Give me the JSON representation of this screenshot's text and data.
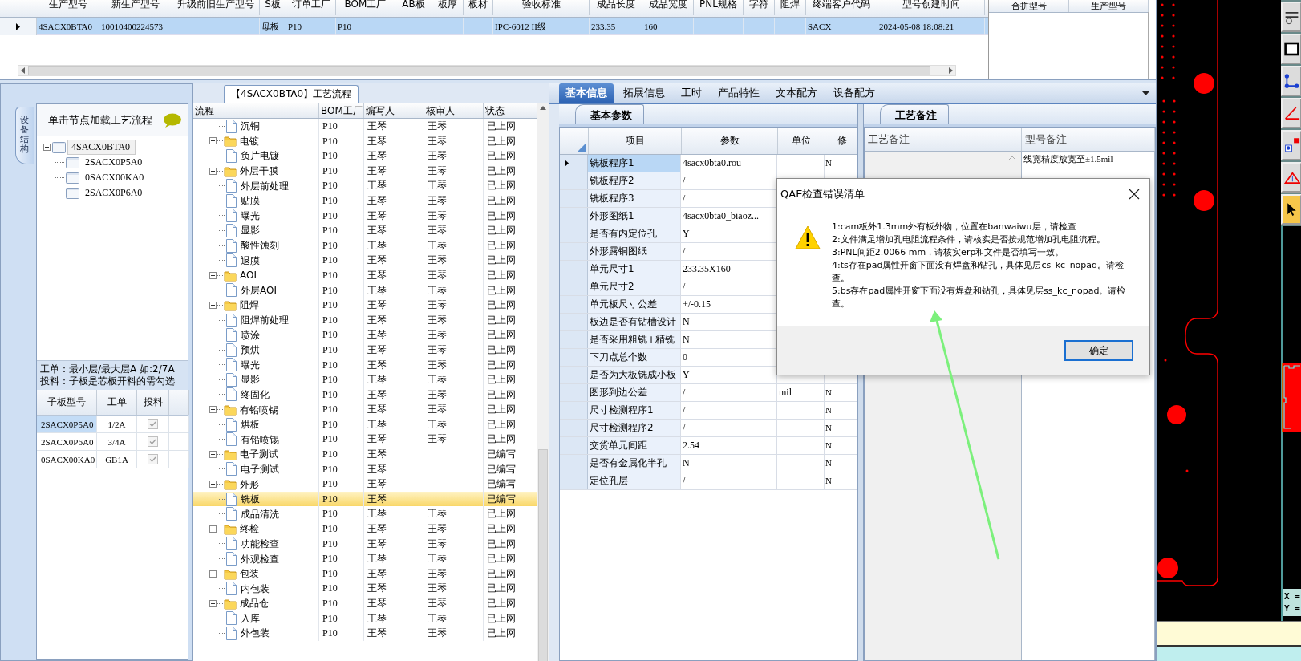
{
  "top_grid": {
    "columns": [
      "生产型号",
      "新生产型号",
      "升级前旧生产型号",
      "S板",
      "订单工厂",
      "BOM工厂",
      "AB板",
      "板厚",
      "板材",
      "验收标准",
      "成品长度",
      "成品宽度",
      "PNL规格",
      "字符",
      "阻焊",
      "终端客户代码",
      "型号创建时间"
    ],
    "rows": [
      {
        "selected": true,
        "cells": [
          "4SACX0BTA0",
          "10010400224573",
          null,
          "母板",
          "P10",
          "P10",
          null,
          null,
          null,
          "IPC-6012 II级",
          "233.35",
          "160",
          null,
          null,
          null,
          "SACX",
          "2024-05-08 18:08:21"
        ]
      }
    ]
  },
  "merge_grid": {
    "columns": [
      "合拼型号",
      "生产型号"
    ]
  },
  "left_panel": {
    "side_tab": "设备结构",
    "header": "单击节点加载工艺流程",
    "tree": [
      {
        "label": "4SACX0BTA0",
        "selected": true,
        "expanded": true,
        "children": [
          {
            "label": "2SACX0P5A0",
            "selected": false
          },
          {
            "label": "0SACX00KA0",
            "selected": false
          },
          {
            "label": "2SACX0P6A0",
            "selected": false
          }
        ]
      }
    ],
    "notes": [
      "工单：最小层/最大层A 如:2/7A",
      "投料：子板是芯板开料的需勾选"
    ],
    "sub_table": {
      "columns": [
        "子板型号",
        "工单",
        "投料"
      ],
      "rows": [
        {
          "model": "2SACX0P5A0",
          "order": "1/2A",
          "checked": true,
          "disabled": true,
          "selected": true
        },
        {
          "model": "2SACX0P6A0",
          "order": "3/4A",
          "checked": true,
          "disabled": true,
          "selected": false
        },
        {
          "model": "0SACX00KA0",
          "order": "GB1A",
          "checked": true,
          "disabled": true,
          "selected": false
        }
      ]
    }
  },
  "process": {
    "title": "【4SACX0BTA0】工艺流程",
    "columns": [
      "流程",
      "BOM工厂",
      "编写人",
      "核审人",
      "状态"
    ],
    "rows": [
      {
        "kind": "step",
        "name": "沉铜",
        "bom": "P10",
        "writer": "王琴",
        "reviewer": "王琴",
        "status": "已上网",
        "selected": false
      },
      {
        "kind": "group",
        "name": "电镀",
        "bom": "P10",
        "writer": "王琴",
        "reviewer": "王琴",
        "status": "已上网",
        "selected": false,
        "expanded": true,
        "children": [
          {
            "kind": "step",
            "name": "负片电镀",
            "bom": "P10",
            "writer": "王琴",
            "reviewer": "王琴",
            "status": "已上网",
            "selected": false
          }
        ]
      },
      {
        "kind": "group",
        "name": "外层干膜",
        "bom": "P10",
        "writer": "王琴",
        "reviewer": "王琴",
        "status": "已上网",
        "selected": false,
        "expanded": true,
        "children": [
          {
            "kind": "step",
            "name": "外层前处理",
            "bom": "P10",
            "writer": "王琴",
            "reviewer": "王琴",
            "status": "已上网",
            "selected": false
          },
          {
            "kind": "step",
            "name": "贴膜",
            "bom": "P10",
            "writer": "王琴",
            "reviewer": "王琴",
            "status": "已上网",
            "selected": false
          },
          {
            "kind": "step",
            "name": "曝光",
            "bom": "P10",
            "writer": "王琴",
            "reviewer": "王琴",
            "status": "已上网",
            "selected": false
          },
          {
            "kind": "step",
            "name": "显影",
            "bom": "P10",
            "writer": "王琴",
            "reviewer": "王琴",
            "status": "已上网",
            "selected": false
          },
          {
            "kind": "step",
            "name": "酸性蚀刻",
            "bom": "P10",
            "writer": "王琴",
            "reviewer": "王琴",
            "status": "已上网",
            "selected": false
          },
          {
            "kind": "step",
            "name": "退膜",
            "bom": "P10",
            "writer": "王琴",
            "reviewer": "王琴",
            "status": "已上网",
            "selected": false
          }
        ]
      },
      {
        "kind": "group",
        "name": "AOI",
        "bom": "P10",
        "writer": "王琴",
        "reviewer": "王琴",
        "status": "已上网",
        "selected": false,
        "expanded": true,
        "children": [
          {
            "kind": "step",
            "name": "外层AOI",
            "bom": "P10",
            "writer": "王琴",
            "reviewer": "王琴",
            "status": "已上网",
            "selected": false
          }
        ]
      },
      {
        "kind": "group",
        "name": "阻焊",
        "bom": "P10",
        "writer": "王琴",
        "reviewer": "王琴",
        "status": "已上网",
        "selected": false,
        "expanded": true,
        "children": [
          {
            "kind": "step",
            "name": "阻焊前处理",
            "bom": "P10",
            "writer": "王琴",
            "reviewer": "王琴",
            "status": "已上网",
            "selected": false
          },
          {
            "kind": "step",
            "name": "喷涂",
            "bom": "P10",
            "writer": "王琴",
            "reviewer": "王琴",
            "status": "已上网",
            "selected": false
          },
          {
            "kind": "step",
            "name": "预烘",
            "bom": "P10",
            "writer": "王琴",
            "reviewer": "王琴",
            "status": "已上网",
            "selected": false
          },
          {
            "kind": "step",
            "name": "曝光",
            "bom": "P10",
            "writer": "王琴",
            "reviewer": "王琴",
            "status": "已上网",
            "selected": false
          },
          {
            "kind": "step",
            "name": "显影",
            "bom": "P10",
            "writer": "王琴",
            "reviewer": "王琴",
            "status": "已上网",
            "selected": false
          },
          {
            "kind": "step",
            "name": "终固化",
            "bom": "P10",
            "writer": "王琴",
            "reviewer": "王琴",
            "status": "已上网",
            "selected": false
          }
        ]
      },
      {
        "kind": "group",
        "name": "有铅喷锡",
        "bom": "P10",
        "writer": "王琴",
        "reviewer": "王琴",
        "status": "已上网",
        "selected": false,
        "expanded": true,
        "children": [
          {
            "kind": "step",
            "name": "烘板",
            "bom": "P10",
            "writer": "王琴",
            "reviewer": "王琴",
            "status": "已上网",
            "selected": false
          },
          {
            "kind": "step",
            "name": "有铅喷锡",
            "bom": "P10",
            "writer": "王琴",
            "reviewer": "王琴",
            "status": "已上网",
            "selected": false
          }
        ]
      },
      {
        "kind": "group",
        "name": "电子测试",
        "bom": "P10",
        "writer": "王琴",
        "status": "已编写",
        "selected": false,
        "expanded": true,
        "children": [
          {
            "kind": "step",
            "name": "电子测试",
            "bom": "P10",
            "writer": "王琴",
            "status": "已编写",
            "selected": false
          }
        ]
      },
      {
        "kind": "group",
        "name": "外形",
        "bom": "P10",
        "writer": "王琴",
        "status": "已编写",
        "selected": false,
        "expanded": true,
        "children": [
          {
            "kind": "step",
            "name": "铣板",
            "bom": "P10",
            "writer": "王琴",
            "status": "已编写",
            "selected": true
          },
          {
            "kind": "step",
            "name": "成品清洗",
            "bom": "P10",
            "writer": "王琴",
            "reviewer": "王琴",
            "status": "已上网",
            "selected": false
          }
        ]
      },
      {
        "kind": "group",
        "name": "终检",
        "bom": "P10",
        "writer": "王琴",
        "reviewer": "王琴",
        "status": "已上网",
        "selected": false,
        "expanded": true,
        "children": [
          {
            "kind": "step",
            "name": "功能检查",
            "bom": "P10",
            "writer": "王琴",
            "reviewer": "王琴",
            "status": "已上网",
            "selected": false
          },
          {
            "kind": "step",
            "name": "外观检查",
            "bom": "P10",
            "writer": "王琴",
            "reviewer": "王琴",
            "status": "已上网",
            "selected": false
          }
        ]
      },
      {
        "kind": "group",
        "name": "包装",
        "bom": "P10",
        "writer": "王琴",
        "reviewer": "王琴",
        "status": "已上网",
        "selected": false,
        "expanded": true,
        "children": [
          {
            "kind": "step",
            "name": "内包装",
            "bom": "P10",
            "writer": "王琴",
            "reviewer": "王琴",
            "status": "已上网",
            "selected": false
          }
        ]
      },
      {
        "kind": "group",
        "name": "成品仓",
        "bom": "P10",
        "writer": "王琴",
        "reviewer": "王琴",
        "status": "已上网",
        "selected": false,
        "expanded": true,
        "children": [
          {
            "kind": "step",
            "name": "入库",
            "bom": "P10",
            "writer": "王琴",
            "reviewer": "王琴",
            "status": "已上网",
            "selected": false
          },
          {
            "kind": "step",
            "name": "外包装",
            "bom": "P10",
            "writer": "王琴",
            "reviewer": "王琴",
            "status": "已上网",
            "selected": false
          }
        ]
      }
    ]
  },
  "detail_tabs": [
    {
      "label": "基本信息",
      "selected": true
    },
    {
      "label": "拓展信息",
      "selected": false
    },
    {
      "label": "工时",
      "selected": false
    },
    {
      "label": "产品特性",
      "selected": false
    },
    {
      "label": "文本配方",
      "selected": false
    },
    {
      "label": "设备配方",
      "selected": false
    }
  ],
  "basic_params": {
    "title": "基本参数",
    "columns": [
      "项目",
      "参数",
      "单位",
      "修"
    ],
    "rows": [
      {
        "item": "铣板程序1",
        "value": "4sacx0bta0.rou",
        "modified": "N",
        "selected": true
      },
      {
        "item": "铣板程序2",
        "value": "/",
        "selected": false
      },
      {
        "item": "铣板程序3",
        "value": "/",
        "selected": false
      },
      {
        "item": "外形图纸1",
        "value": "4sacx0bta0_biaoz...",
        "selected": false
      },
      {
        "item": "是否有内定位孔",
        "value": "Y",
        "selected": false
      },
      {
        "item": "外形露铜图纸",
        "value": "/",
        "selected": false
      },
      {
        "item": "单元尺寸1",
        "value": "233.35X160",
        "selected": false
      },
      {
        "item": "单元尺寸2",
        "value": "/",
        "selected": false
      },
      {
        "item": "单元板尺寸公差",
        "value": "+/-0.15",
        "selected": false
      },
      {
        "item": "板边是否有钻槽设计",
        "value": "N",
        "selected": false
      },
      {
        "item": "是否采用粗铣+精铣",
        "value": "N",
        "selected": false
      },
      {
        "item": "下刀点总个数",
        "value": "0",
        "selected": false
      },
      {
        "item": "是否为大板铣成小板",
        "value": "Y",
        "selected": false
      },
      {
        "item": "图形到边公差",
        "value": "/",
        "unit": "mil",
        "modified": "N",
        "selected": false
      },
      {
        "item": "尺寸检测程序1",
        "value": "/",
        "modified": "N",
        "selected": false
      },
      {
        "item": "尺寸检测程序2",
        "value": "/",
        "modified": "N",
        "selected": false
      },
      {
        "item": "交货单元间距",
        "value": "2.54",
        "modified": "N",
        "selected": false
      },
      {
        "item": "是否有金属化半孔",
        "value": "N",
        "modified": "N",
        "selected": false
      },
      {
        "item": "定位孔层",
        "value": "/",
        "modified": "N",
        "selected": false
      }
    ]
  },
  "remarks": {
    "title": "工艺备注",
    "columns": [
      "工艺备注",
      "型号备注"
    ],
    "model_remark": "线宽精度放宽至±1.5mil"
  },
  "dialog": {
    "title": "QAE检查错误清单",
    "messages": [
      "1:cam板外1.3mm外有板外物，位置在banwaiwu层，请检查",
      "2:文件满足增加孔电阻流程条件，请核实是否按规范增加孔电阻流程。",
      "3:PNL间距2.0066 mm，请核实erp和文件是否填写一致。",
      "4:ts存在pad属性开窗下面没有焊盘和钻孔，具体见层cs_kc_nopad。请检查。",
      "5:bs存在pad属性开窗下面没有焊盘和钻孔，具体见层ss_kc_nopad。请检查。"
    ],
    "button": "确定"
  },
  "cad": {
    "coords": [
      "X =",
      "Y ="
    ]
  }
}
